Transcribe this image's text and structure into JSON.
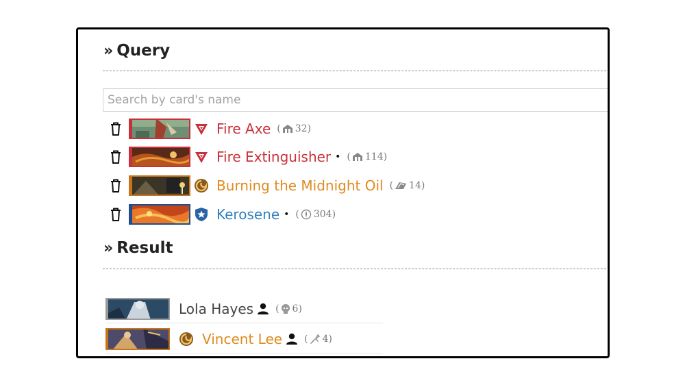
{
  "query": {
    "title": "Query",
    "search_placeholder": "Search by card's name",
    "cards": [
      {
        "name": "Fire Axe",
        "unique": false,
        "meta_icon": "bank-icon",
        "meta_value": "32",
        "color": "#c8313b",
        "border": "#c8313b",
        "faction": "anarch-icon"
      },
      {
        "name": "Fire Extinguisher",
        "unique": true,
        "meta_icon": "bank-icon",
        "meta_value": "114",
        "color": "#c8313b",
        "border": "#c8313b",
        "faction": "anarch-icon"
      },
      {
        "name": "Burning the Midnight Oil",
        "unique": false,
        "meta_icon": "event-icon",
        "meta_value": "14",
        "color": "#e08a1e",
        "border": "#c9741a",
        "faction": "shaper-icon"
      },
      {
        "name": "Kerosene",
        "unique": true,
        "meta_icon": "agenda-icon",
        "meta_value": "304",
        "color": "#2f7fc1",
        "border": "#1f4e8c",
        "faction": "criminal-icon"
      }
    ],
    "unique_marker": "•"
  },
  "result": {
    "title": "Result",
    "identities": [
      {
        "name": "Lola Hayes",
        "meta_icon": "mind-icon",
        "meta_value": "6",
        "color": "#444444",
        "border": "#9a9a9a"
      },
      {
        "name": "Vincent Lee",
        "meta_icon": "tool-icon",
        "meta_value": "4",
        "color": "#e08a1e",
        "border": "#c9741a"
      }
    ]
  },
  "colors": {
    "anarch": "#c8313b",
    "shaper": "#e08a1e",
    "criminal": "#2f7fc1",
    "neutral": "#444444"
  }
}
